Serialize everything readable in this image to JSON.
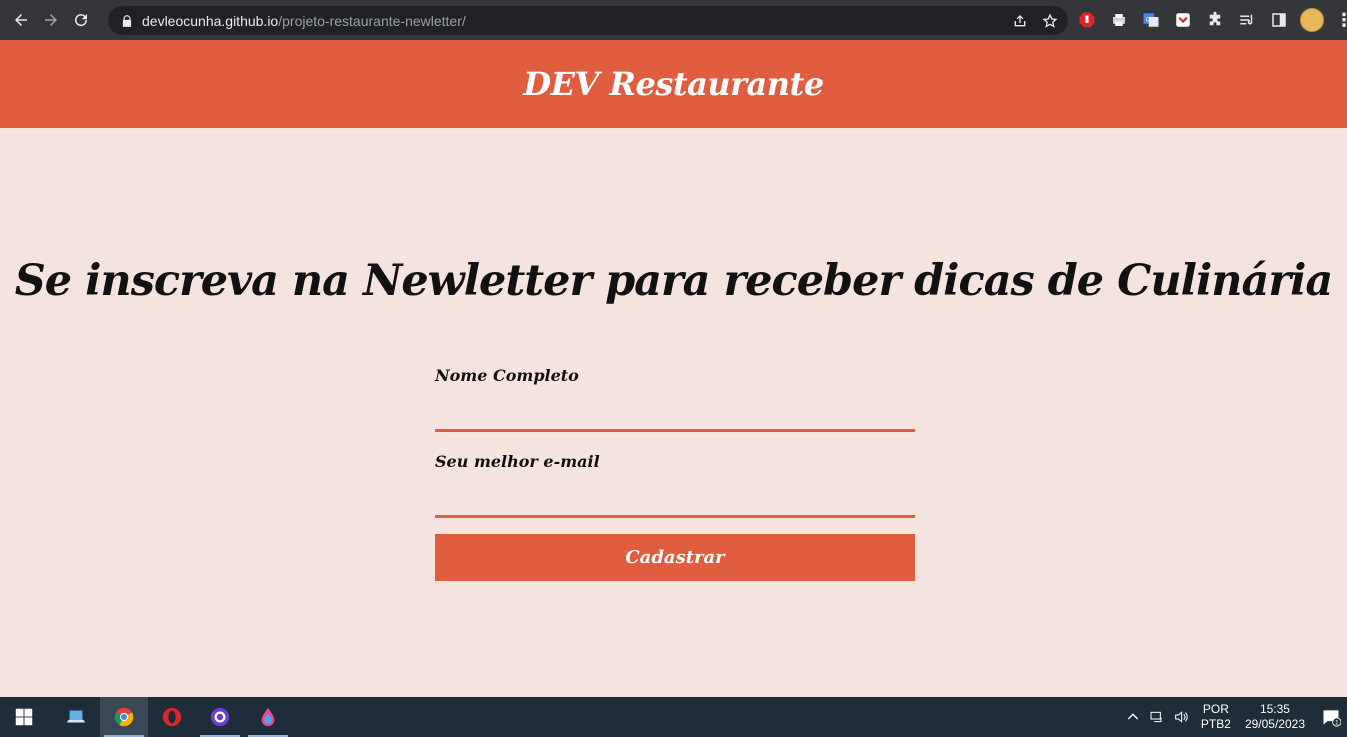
{
  "browser": {
    "url_host": "devleocunha.github.io",
    "url_path": "/projeto-restaurante-newletter/"
  },
  "header": {
    "site_title": "DEV Restaurante"
  },
  "main": {
    "title": "Se inscreva na Newletter para receber dicas de Culinária",
    "form": {
      "name_label": "Nome Completo",
      "email_label": "Seu melhor e-mail",
      "submit_label": "Cadastrar"
    }
  },
  "taskbar": {
    "apps": [
      "start-icon",
      "laptop-icon",
      "chrome-icon",
      "opera-icon",
      "github-desktop-icon",
      "drop-icon"
    ]
  },
  "tray": {
    "lang_line1": "POR",
    "lang_line2": "PTB2",
    "time": "15:35",
    "date": "29/05/2023",
    "notification_count": "1"
  },
  "colors": {
    "brand": "#e05d3f",
    "page_background": "#f5e3e0",
    "browser_chrome": "#35363a",
    "taskbar": "#1f2c3a"
  }
}
